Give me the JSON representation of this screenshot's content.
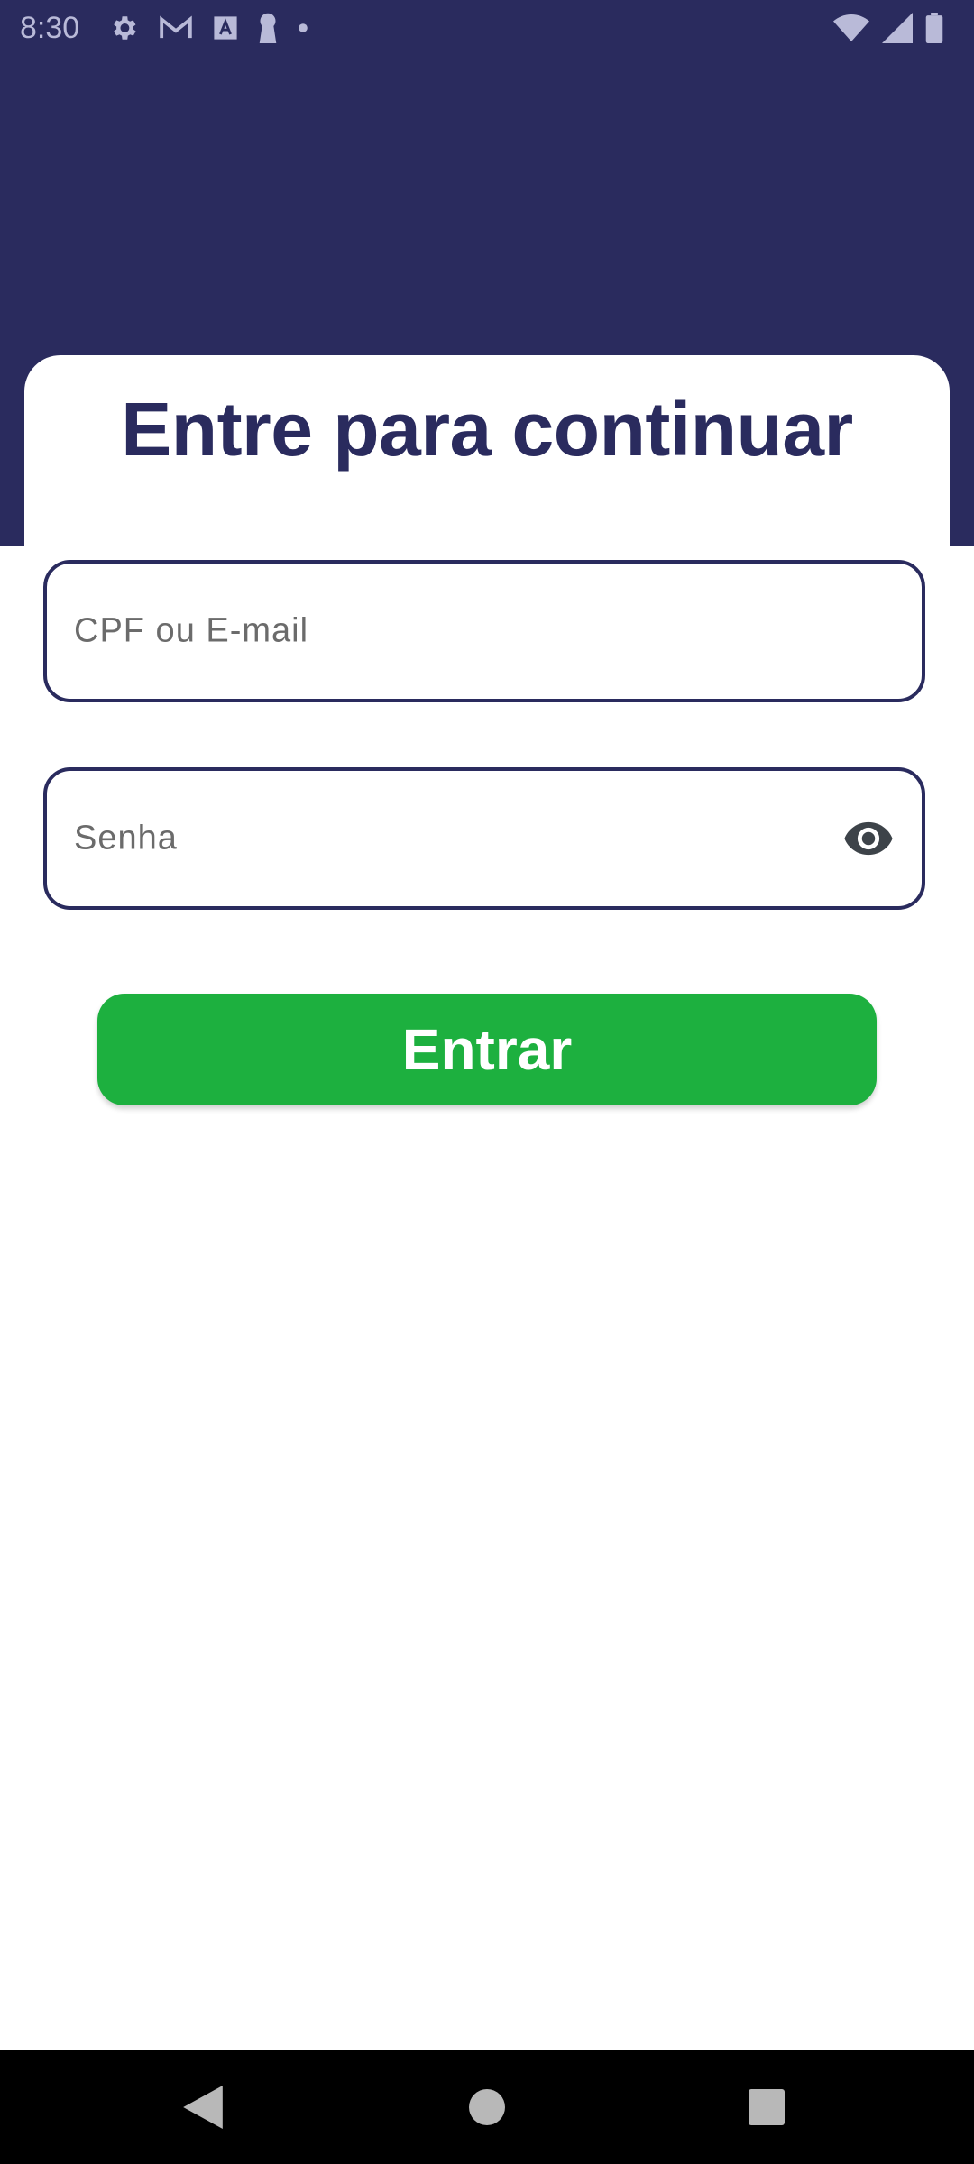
{
  "status_bar": {
    "time": "8:30",
    "left_icons": [
      "settings-icon",
      "gmail-icon",
      "font-icon",
      "keyhole-icon",
      "dot-icon"
    ],
    "right_icons": [
      "wifi-icon",
      "signal-icon",
      "battery-icon"
    ]
  },
  "login": {
    "title": "Entre para continuar",
    "email_placeholder": "CPF ou E-mail",
    "email_value": "",
    "password_placeholder": "Senha",
    "password_value": "",
    "visibility_icon": "eye-icon",
    "submit_label": "Entrar"
  },
  "navigation": {
    "back_icon": "back-triangle-icon",
    "home_icon": "home-circle-icon",
    "recents_icon": "recents-square-icon"
  },
  "colors": {
    "primary_navy": "#2a2b5e",
    "accent_green": "#1db03f",
    "background": "#ffffff",
    "nav_bar": "#000000"
  }
}
